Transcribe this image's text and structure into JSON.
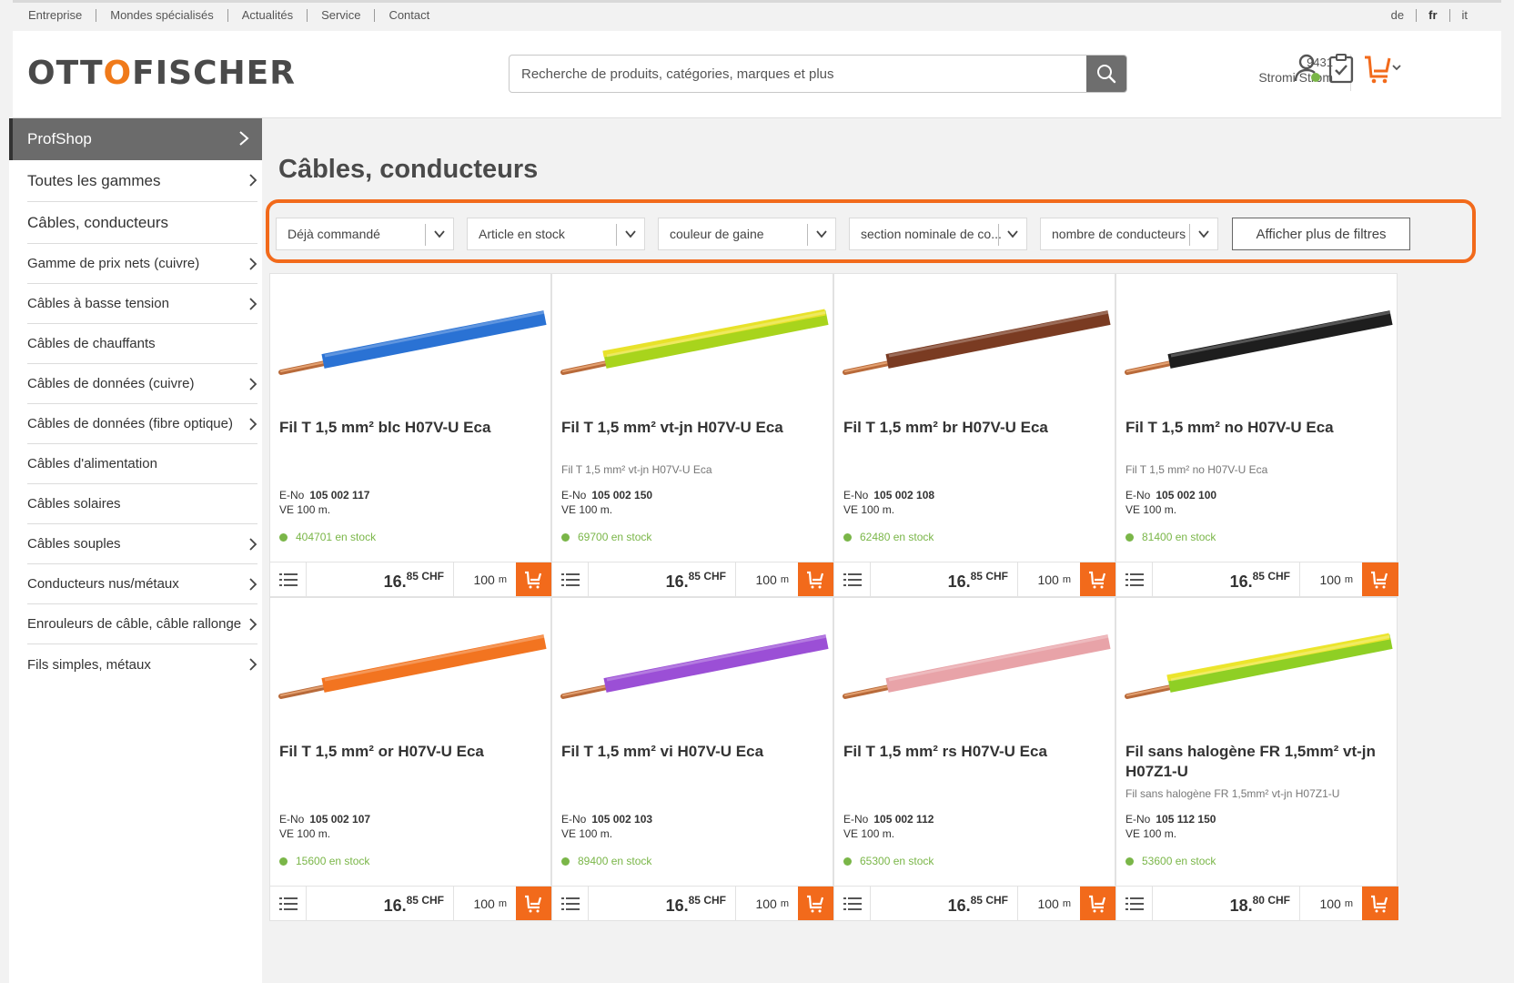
{
  "topnav": {
    "items": [
      "Entreprise",
      "Mondes spécialisés",
      "Actualités",
      "Service",
      "Contact"
    ],
    "langs": [
      "de",
      "fr",
      "it"
    ]
  },
  "header": {
    "logo_left": "OTT",
    "logo_mid": "O",
    "logo_right": "FISCHER",
    "search_placeholder": "Recherche de produits, catégories, marques et plus",
    "account_number": "9431",
    "account_name": "Stromi Strom"
  },
  "sidebar": {
    "head": "ProfShop",
    "items": [
      {
        "label": "Toutes les gammes",
        "chevron": true,
        "big": true
      },
      {
        "label": "Câbles, conducteurs",
        "chevron": false,
        "big": true
      },
      {
        "label": "Gamme de prix nets (cuivre)",
        "chevron": true
      },
      {
        "label": "Câbles à basse tension",
        "chevron": true
      },
      {
        "label": "Câbles de chauffants",
        "chevron": false
      },
      {
        "label": "Câbles de données (cuivre)",
        "chevron": true
      },
      {
        "label": "Câbles de données (fibre optique)",
        "chevron": true
      },
      {
        "label": "Câbles d'alimentation",
        "chevron": false
      },
      {
        "label": "Câbles solaires",
        "chevron": false
      },
      {
        "label": "Câbles souples",
        "chevron": true
      },
      {
        "label": "Conducteurs nus/métaux",
        "chevron": true
      },
      {
        "label": "Enrouleurs de câble, câble rallonge",
        "chevron": true
      },
      {
        "label": "Fils simples, métaux",
        "chevron": true
      }
    ]
  },
  "main": {
    "title": "Câbles, conducteurs",
    "filters": [
      "Déjà commandé",
      "Article en stock",
      "couleur de gaine",
      "section nominale de co...",
      "nombre de conducteurs"
    ],
    "more_filters": "Afficher plus de filtres"
  },
  "products": [
    {
      "title": "Fil T 1,5 mm² blc H07V-U Eca",
      "sub": "",
      "eno_label": "E-No",
      "eno": "105 002 117",
      "ve": "VE 100 m.",
      "stock": "404701 en stock",
      "price_int": "16.",
      "price_dec": "85",
      "currency": "CHF",
      "qty": "100",
      "unit": "m",
      "color": "#2a72d4"
    },
    {
      "title": "Fil T 1,5 mm² vt-jn H07V-U Eca",
      "sub": "Fil T 1,5 mm² vt-jn H07V-U Eca",
      "eno_label": "E-No",
      "eno": "105 002 150",
      "ve": "VE 100 m.",
      "stock": "69700 en stock",
      "price_int": "16.",
      "price_dec": "85",
      "currency": "CHF",
      "qty": "100",
      "unit": "m",
      "color": "#a8d41c",
      "stripe": "#e8e22a"
    },
    {
      "title": "Fil T 1,5 mm² br H07V-U Eca",
      "sub": "",
      "eno_label": "E-No",
      "eno": "105 002 108",
      "ve": "VE 100 m.",
      "stock": "62480 en stock",
      "price_int": "16.",
      "price_dec": "85",
      "currency": "CHF",
      "qty": "100",
      "unit": "m",
      "color": "#7a3b22"
    },
    {
      "title": "Fil T 1,5 mm² no H07V-U Eca",
      "sub": "Fil T 1,5 mm² no H07V-U Eca",
      "eno_label": "E-No",
      "eno": "105 002 100",
      "ve": "VE 100 m.",
      "stock": "81400 en stock",
      "price_int": "16.",
      "price_dec": "85",
      "currency": "CHF",
      "qty": "100",
      "unit": "m",
      "color": "#1e1e1e"
    },
    {
      "title": "Fil T 1,5 mm² or H07V-U Eca",
      "sub": "",
      "eno_label": "E-No",
      "eno": "105 002 107",
      "ve": "VE 100 m.",
      "stock": "15600 en stock",
      "price_int": "16.",
      "price_dec": "85",
      "currency": "CHF",
      "qty": "100",
      "unit": "m",
      "color": "#f27420"
    },
    {
      "title": "Fil T 1,5 mm² vi H07V-U Eca",
      "sub": "",
      "eno_label": "E-No",
      "eno": "105 002 103",
      "ve": "VE 100 m.",
      "stock": "89400 en stock",
      "price_int": "16.",
      "price_dec": "85",
      "currency": "CHF",
      "qty": "100",
      "unit": "m",
      "color": "#9b4fd6"
    },
    {
      "title": "Fil T 1,5 mm² rs H07V-U Eca",
      "sub": "",
      "eno_label": "E-No",
      "eno": "105 002 112",
      "ve": "VE 100 m.",
      "stock": "65300 en stock",
      "price_int": "16.",
      "price_dec": "85",
      "currency": "CHF",
      "qty": "100",
      "unit": "m",
      "color": "#e8a3a8"
    },
    {
      "title": "Fil sans halogène FR 1,5mm² vt-jn H07Z1-U",
      "sub": "Fil sans halogène FR 1,5mm² vt-jn H07Z1-U",
      "eno_label": "E-No",
      "eno": "105 112 150",
      "ve": "VE 100 m.",
      "stock": "53600 en stock",
      "price_int": "18.",
      "price_dec": "80",
      "currency": "CHF",
      "qty": "100",
      "unit": "m",
      "color": "#8fcf24",
      "stripe": "#ece52c"
    }
  ],
  "colors": {
    "accent": "#f26a1b",
    "stock": "#7ab648",
    "sidebar_head": "#6b6b6b"
  }
}
